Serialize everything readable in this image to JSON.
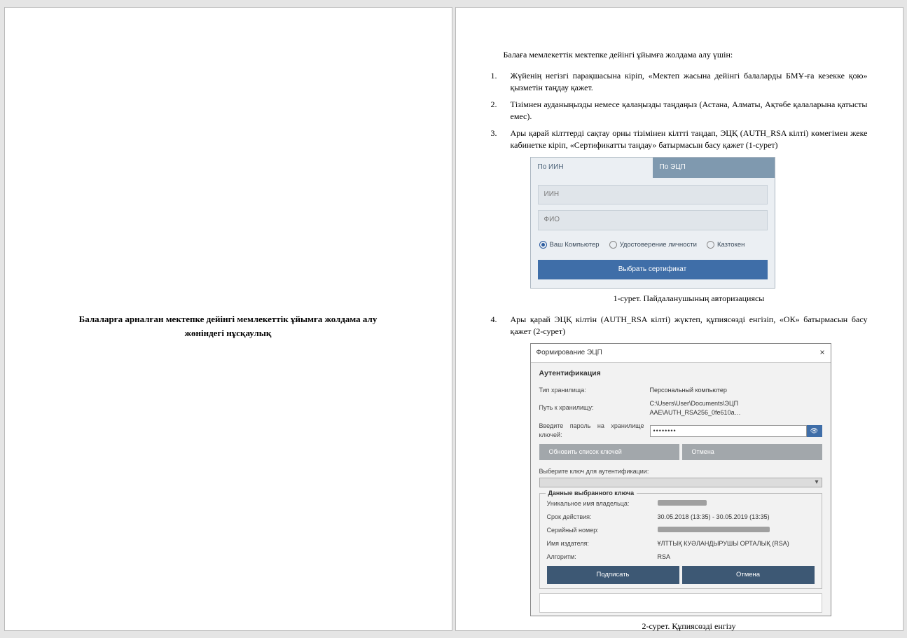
{
  "page1": {
    "title": "Балаларға арналған мектепке дейінгі мемлекеттік ұйымға жолдама алу жөніндегі нұсқаулық"
  },
  "page2": {
    "intro": "Балаға мемлекеттік мектепке дейінгі ұйымға жолдама алу үшін:",
    "items": {
      "i1": "Жүйенің негізгі парақшасына кіріп, «Мектеп жасына дейінгі балаларды БМҰ-ға кезекке қою» қызметін таңдау қажет.",
      "i2": "Тізімнен ауданыңызды немесе қалаңызды таңдаңыз (Астана, Алматы, Ақтөбе қалаларына қатысты емес).",
      "i3": "Ары қарай кілттерді сақтау орны тізімінен кілтті таңдап, ЭЦҚ (AUTH_RSA кілті) көмегімен жеке кабинетке кіріп, «Сертификатты таңдау» батырмасын басу қажет (1-сурет)",
      "i4": "Ары қарай ЭЦҚ кілтін (AUTH_RSA кілті) жүктеп, құпиясөзді енгізіп, «ОК» батырмасын басу қажет  (2-сурет)"
    },
    "fig1": {
      "tab_iin": "По ИИН",
      "tab_ecp": "По ЭЦП",
      "ph_iin": "ИИН",
      "ph_fio": "ФИО",
      "r1": "Ваш Компьютер",
      "r2": "Удостоверение личности",
      "r3": "Казтокен",
      "btn": "Выбрать сертификат",
      "caption": "1-сурет. Пайдаланушының авторизациясы"
    },
    "fig2": {
      "title": "Формирование ЭЦП",
      "h": "Аутентификация",
      "l_type": "Тип хранилища:",
      "v_type": "Персональный компьютер",
      "l_path": "Путь к хранилищу:",
      "v_path": "C:\\Users\\User\\Documents\\ЭЦП ААЕ\\AUTH_RSA256_0fe610a…",
      "l_pw": "Введите пароль на хранилище ключей:",
      "v_pw": "••••••••",
      "btn_refresh": "Обновить список ключей",
      "btn_cancel1": "Отмена",
      "subhead": "Выберите ключ для аутентификации:",
      "fs_legend": "Данные выбранного ключа",
      "l_owner": "Уникальное имя владельца:",
      "l_validity": "Срок действия:",
      "v_validity": "30.05.2018 (13:35) - 30.05.2019 (13:35)",
      "l_serial": "Серийный номер:",
      "l_issuer": "Имя издателя:",
      "v_issuer": "ҰЛТТЫҚ КУӘЛАНДЫРУШЫ ОРТАЛЫҚ (RSA)",
      "l_algo": "Алгоритм:",
      "v_algo": "RSA",
      "btn_sign": "Подписать",
      "btn_cancel2": "Отмена",
      "caption": "2-сурет. Құпиясөзді енгізу"
    }
  }
}
